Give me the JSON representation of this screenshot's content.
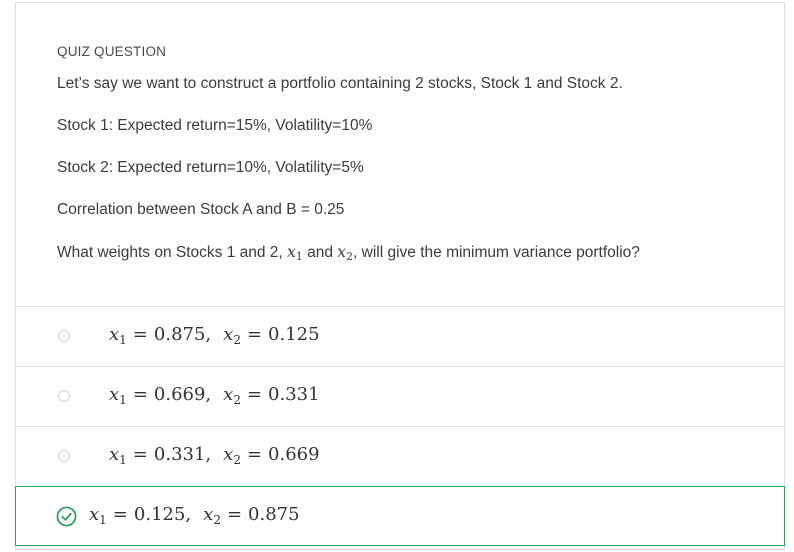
{
  "quiz": {
    "header": "QUIZ QUESTION",
    "question": {
      "line1": "Let’s say we want to construct a portfolio containing 2 stocks, Stock 1 and Stock 2.",
      "line2": "Stock 1: Expected return=15%, Volatility=10%",
      "line3": "Stock 2: Expected return=10%, Volatility=5%",
      "line4": "Correlation between Stock A and B = 0.25",
      "line5_before": "What weights on Stocks 1 and 2, ",
      "line5_var1": "x",
      "line5_sub1": "1",
      "line5_and": " and ",
      "line5_var2": "x",
      "line5_sub2": "2",
      "line5_after": ", will give the minimum variance portfolio?"
    },
    "options": [
      {
        "x1": "0.875",
        "x2": "0.125",
        "selected": false
      },
      {
        "x1": "0.669",
        "x2": "0.331",
        "selected": false
      },
      {
        "x1": "0.331",
        "x2": "0.669",
        "selected": false
      },
      {
        "x1": "0.125",
        "x2": "0.875",
        "selected": true
      }
    ],
    "math_symbols": {
      "var": "x",
      "sub1": "1",
      "sub2": "2",
      "eq": "=",
      "comma": ","
    },
    "colors": {
      "correct": "#2e9e5b",
      "border": "#dedede",
      "text": "#3b3b3b"
    },
    "icons": {
      "unselected": "radio-circle-icon",
      "selected": "check-circle-icon"
    }
  }
}
